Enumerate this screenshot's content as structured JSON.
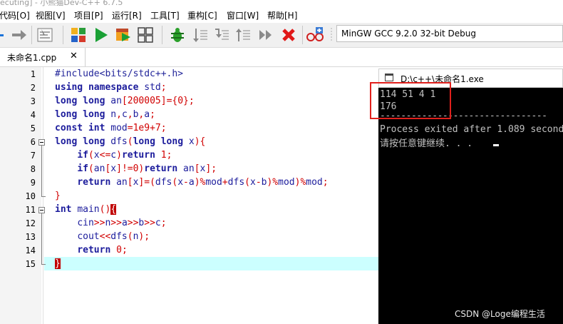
{
  "window": {
    "title_partial": "ecuting] - 小熊猫Dev-C++ 6.7.5"
  },
  "menu": [
    "代码[O]",
    "视图[V]",
    "项目[P]",
    "运行[R]",
    "工具[T]",
    "重构[C]",
    "窗口[W]",
    "帮助[H]"
  ],
  "toolbar": {
    "icons": [
      "forward-arrow-icon",
      "format-code-icon",
      "compile-icon",
      "run-icon",
      "compile-run-icon",
      "rebuild-all-icon",
      "debug-icon",
      "step-over-icon",
      "step-into-icon",
      "step-out-icon",
      "continue-icon",
      "stop-icon",
      "profile-icon"
    ],
    "compiler_select": "MinGW GCC 9.2.0 32-bit Debug"
  },
  "tab": {
    "label": "未命名1.cpp",
    "close": "✕"
  },
  "editor": {
    "line_numbers": [
      "1",
      "2",
      "3",
      "4",
      "5",
      "6",
      "7",
      "8",
      "9",
      "10",
      "11",
      "12",
      "13",
      "14",
      "15"
    ],
    "lines": [
      "#include<bits/stdc++.h>",
      "using namespace std;",
      "long long an[200005]={0};",
      "long long n,c,b,a;",
      "const int mod=1e9+7;",
      "long long dfs(long long x){",
      "    if(x<=c)return 1;",
      "    if(an[x]!=0)return an[x];",
      "    return an[x]=(dfs(x-a)%mod+dfs(x-b)%mod)%mod;",
      "}",
      "int main(){",
      "    cin>>n>>a>>b>>c;",
      "    cout<<dfs(n);",
      "    return 0;",
      "}"
    ],
    "current_line": 15
  },
  "console": {
    "title": "D:\\c++\\未命名1.exe",
    "lines": [
      "114 51 4 1",
      "176",
      "--------------------------------",
      "Process exited after 1.089 seconds",
      "请按任意键继续. . ."
    ]
  },
  "watermark": "CSDN @Loge编程生活",
  "colors": {
    "highlight_line": "#ccffff",
    "red_box": "#e0201c",
    "keyword": "#1c1c9c",
    "operator": "#d10000",
    "console_bg": "#000000"
  }
}
